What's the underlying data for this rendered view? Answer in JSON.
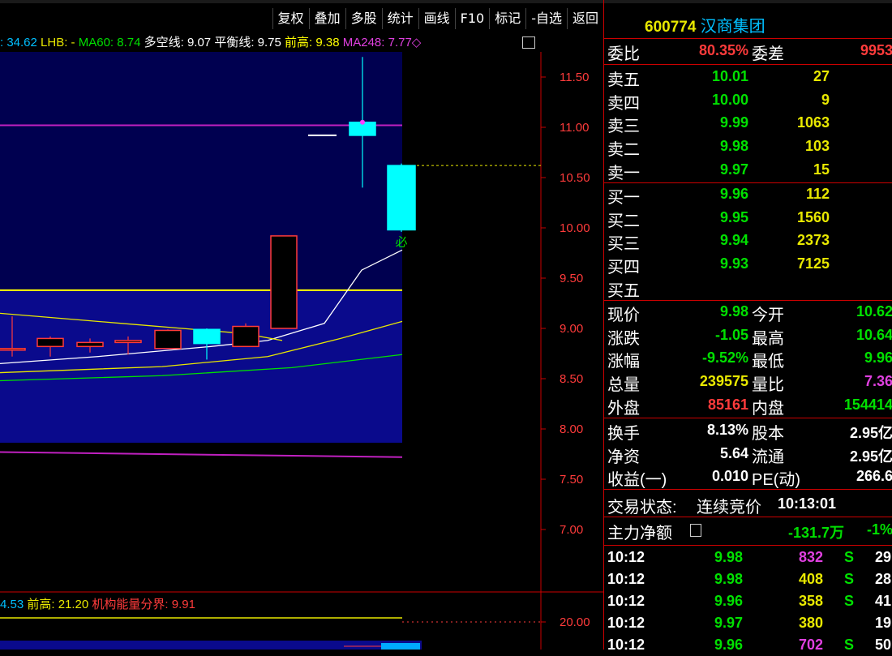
{
  "toolbar": {
    "items": [
      "复权",
      "叠加",
      "多股",
      "统计",
      "画线",
      "F10",
      "标记",
      "-自选",
      "返回"
    ]
  },
  "indicator": {
    "i1": ": 34.62",
    "i2": "LHB: -",
    "i3": "MA60: 8.74",
    "i4": "多空线: 9.07",
    "i5": "平衡线: 9.75",
    "i6": "前高: 9.38",
    "i7": "MA248: 7.77◇"
  },
  "chart_data": {
    "type": "candlestick",
    "y_axis": {
      "ticks": [
        "11.50",
        "11.00",
        "10.50",
        "10.00",
        "9.50",
        "9.00",
        "8.50",
        "8.00",
        "7.50",
        "7.00"
      ],
      "range": [
        6.75,
        11.75
      ]
    },
    "candles": [
      {
        "open": 8.8,
        "close": 8.8,
        "high": 9.12,
        "low": 8.72
      },
      {
        "open": 8.82,
        "close": 8.9,
        "high": 8.92,
        "low": 8.72
      },
      {
        "open": 8.82,
        "close": 8.86,
        "high": 8.9,
        "low": 8.76
      },
      {
        "open": 8.86,
        "close": 8.88,
        "high": 8.92,
        "low": 8.74
      },
      {
        "open": 8.8,
        "close": 8.98,
        "high": 8.99,
        "low": 8.8
      },
      {
        "open": 8.99,
        "close": 8.85,
        "high": 9.0,
        "low": 8.69
      },
      {
        "open": 8.82,
        "close": 9.02,
        "high": 9.05,
        "low": 8.82
      },
      {
        "open": 9.0,
        "close": 9.92,
        "high": 9.92,
        "low": 9.0
      },
      {
        "open": 11.05,
        "close": 10.92,
        "high": 11.7,
        "low": 10.4
      },
      {
        "open": 10.62,
        "close": 9.98,
        "high": 10.64,
        "low": 9.96
      }
    ],
    "marker_label": "必",
    "levels": {
      "prev_high": 9.38,
      "ma248": 7.77,
      "last_close": 10.62
    },
    "lower_chart": {
      "y_tick": "20.00",
      "labels": {
        "a": "4.53",
        "b": "前高: 21.20",
        "c": "机构能量分界: 9.91"
      }
    }
  },
  "quote": {
    "code": "600774",
    "name": "汉商集团",
    "webi": {
      "label": "委比",
      "value": "80.35%",
      "label2": "委差",
      "value2": "9953"
    },
    "asks": [
      {
        "label": "卖五",
        "price": "10.01",
        "vol": "27"
      },
      {
        "label": "卖四",
        "price": "10.00",
        "vol": "9"
      },
      {
        "label": "卖三",
        "price": "9.99",
        "vol": "1063"
      },
      {
        "label": "卖二",
        "price": "9.98",
        "vol": "103"
      },
      {
        "label": "卖一",
        "price": "9.97",
        "vol": "15"
      }
    ],
    "bids": [
      {
        "label": "买一",
        "price": "9.96",
        "vol": "112"
      },
      {
        "label": "买二",
        "price": "9.95",
        "vol": "1560"
      },
      {
        "label": "买三",
        "price": "9.94",
        "vol": "2373"
      },
      {
        "label": "买四",
        "price": "9.93",
        "vol": "7125"
      },
      {
        "label": "买五",
        "price": "",
        "vol": ""
      }
    ],
    "stats": [
      {
        "l1": "现价",
        "v1": "9.98",
        "l2": "今开",
        "v2": "10.62",
        "c1": "#00e000",
        "c2": "#00e000"
      },
      {
        "l1": "涨跌",
        "v1": "-1.05",
        "l2": "最高",
        "v2": "10.64",
        "c1": "#00e000",
        "c2": "#00e000"
      },
      {
        "l1": "涨幅",
        "v1": "-9.52%",
        "l2": "最低",
        "v2": "9.96",
        "c1": "#00e000",
        "c2": "#00e000"
      },
      {
        "l1": "总量",
        "v1": "239575",
        "l2": "量比",
        "v2": "7.36",
        "c1": "#e8e800",
        "c2": "#e040e0"
      },
      {
        "l1": "外盘",
        "v1": "85161",
        "l2": "内盘",
        "v2": "154414",
        "c1": "#ff3b3b",
        "c2": "#00e000"
      }
    ],
    "stats2": [
      {
        "l1": "换手",
        "v1": "8.13%",
        "l2": "股本",
        "v2": "2.95亿"
      },
      {
        "l1": "净资",
        "v1": "5.64",
        "l2": "流通",
        "v2": "2.95亿"
      },
      {
        "l1": "收益(一)",
        "v1": "0.010",
        "l2": "PE(动)",
        "v2": "266.6"
      }
    ],
    "status": {
      "label": "交易状态:",
      "value": "连续竞价",
      "time": "10:13:01"
    },
    "flow": {
      "label": "主力净额",
      "value": "-131.7万",
      "pct": "-1%"
    },
    "ticks": [
      {
        "time": "10:12",
        "price": "9.98",
        "vol": "832",
        "side": "S",
        "num": "29",
        "vc": "#e040e0"
      },
      {
        "time": "10:12",
        "price": "9.98",
        "vol": "408",
        "side": "S",
        "num": "28",
        "vc": "#e8e800"
      },
      {
        "time": "10:12",
        "price": "9.96",
        "vol": "358",
        "side": "S",
        "num": "41",
        "vc": "#e8e800"
      },
      {
        "time": "10:12",
        "price": "9.97",
        "vol": "380",
        "side": "",
        "num": "19",
        "vc": "#e8e800"
      },
      {
        "time": "10:12",
        "price": "9.96",
        "vol": "702",
        "side": "S",
        "num": "50",
        "vc": "#e040e0"
      }
    ]
  }
}
